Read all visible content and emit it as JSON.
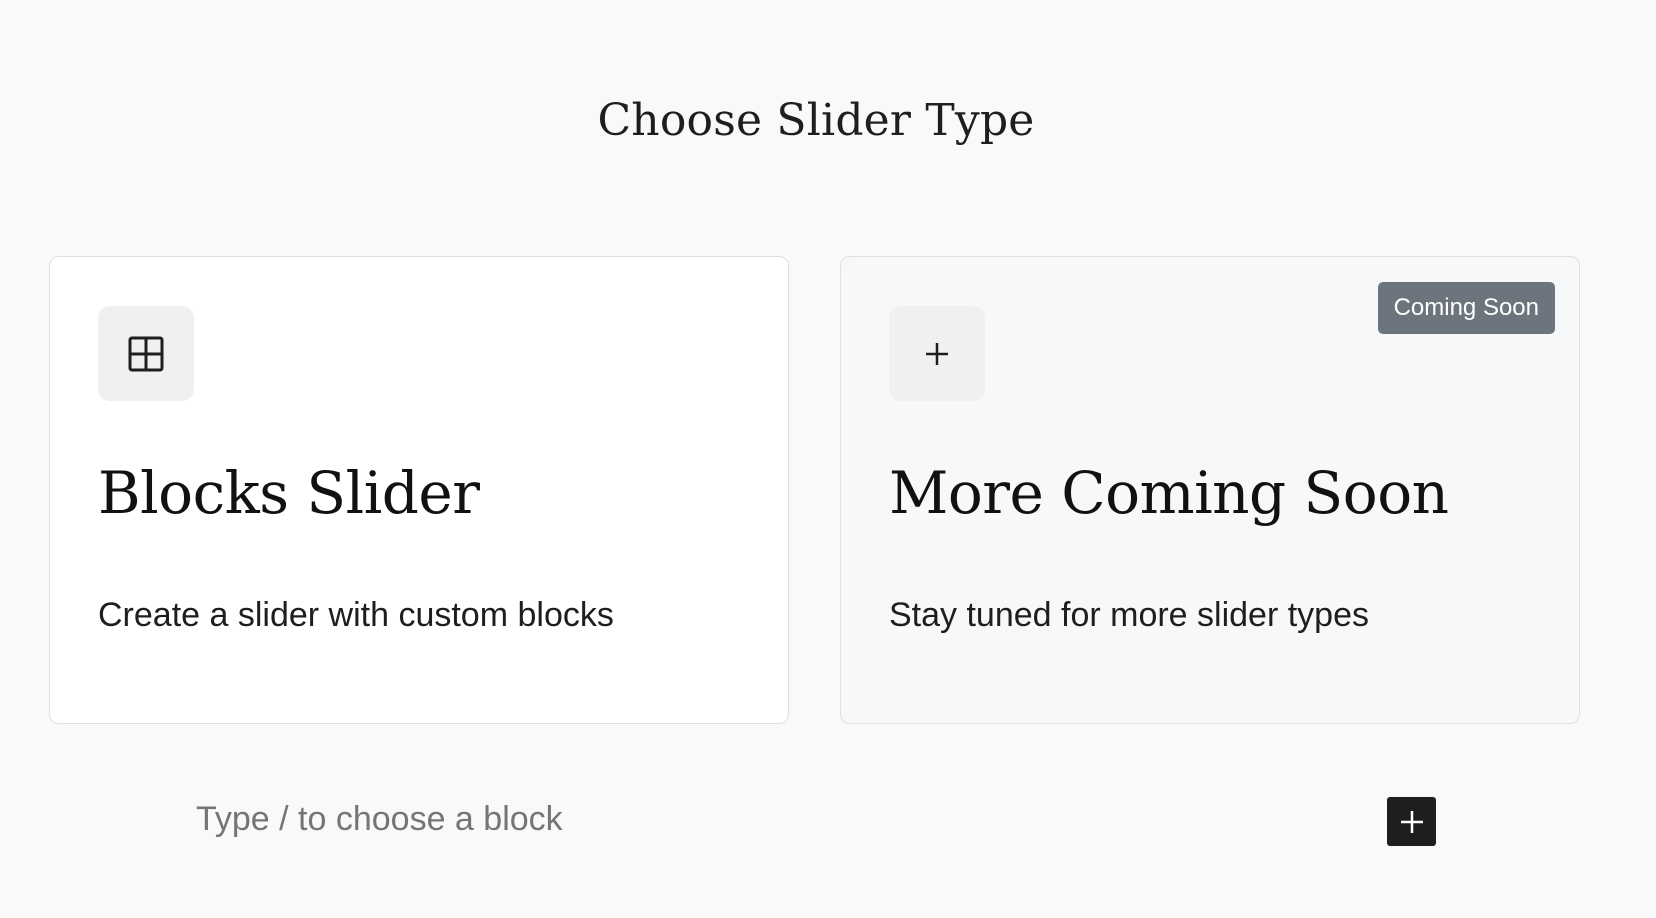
{
  "header": {
    "title": "Choose Slider Type"
  },
  "cards": [
    {
      "title": "Blocks Slider",
      "description": "Create a slider with custom blocks",
      "icon": "grid-icon"
    },
    {
      "title": "More Coming Soon",
      "description": "Stay tuned for more slider types",
      "icon": "plus-icon",
      "badge": "Coming Soon"
    }
  ],
  "appender": {
    "placeholder": "Type / to choose a block",
    "add_icon": "plus-icon"
  },
  "colors": {
    "background": "#f9f9f9",
    "badge": "#6c757d",
    "add_button": "#1e1e1e"
  }
}
